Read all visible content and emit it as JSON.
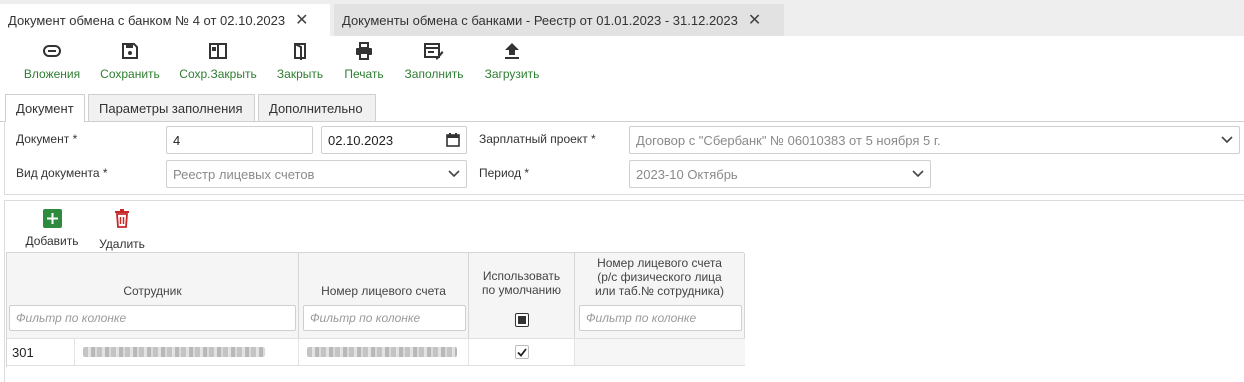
{
  "doc_tabs": [
    {
      "label": "Документ обмена с банком № 4 от 02.10.2023",
      "active": true
    },
    {
      "label": "Документы обмена с банками - Реестр от 01.01.2023 - 31.12.2023",
      "active": false
    }
  ],
  "toolbar": {
    "attachments": "Вложения",
    "save": "Сохранить",
    "save_close": "Сохр.Закрыть",
    "close": "Закрыть",
    "print": "Печать",
    "fill": "Заполнить",
    "upload": "Загрузить"
  },
  "section_tabs": [
    "Документ",
    "Параметры заполнения",
    "Дополнительно"
  ],
  "form": {
    "document_label": "Документ *",
    "document_number": "4",
    "document_date": "02.10.2023",
    "salary_project_label": "Зарплатный проект *",
    "salary_project_value": "Договор с \"Сбербанк\" № 06010383 от 5 ноября 5 г.",
    "doc_type_label": "Вид документа *",
    "doc_type_value": "Реестр лицевых счетов",
    "period_label": "Период *",
    "period_value": "2023-10 Октябрь"
  },
  "table_toolbar": {
    "add": "Добавить",
    "delete": "Удалить"
  },
  "table": {
    "columns": [
      "Сотрудник",
      "Номер лицевого счета",
      "Использовать по умолчанию",
      "Номер лицевого счета (р/с физического лица или таб.№ сотрудника)"
    ],
    "col_lines": [
      [
        "Сотрудник"
      ],
      [
        "Номер лицевого счета"
      ],
      [
        "Использовать",
        "по умолчанию"
      ],
      [
        "Номер лицевого счета",
        "(р/с физического лица",
        "или таб.№ сотрудника)"
      ]
    ],
    "filter_placeholder": "Фильтр по колонке",
    "rows": [
      {
        "employee_code": "301",
        "use_default": true
      }
    ]
  },
  "colors": {
    "accent_green": "#2e7d32",
    "add_button_bg": "#2e8b3d",
    "delete_red": "#c62828"
  }
}
